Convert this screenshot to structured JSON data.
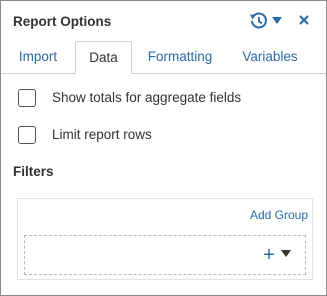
{
  "header": {
    "title": "Report Options",
    "history_icon": "history-icon",
    "close_icon": "close-icon"
  },
  "tabs": [
    {
      "label": "Import",
      "active": false
    },
    {
      "label": "Data",
      "active": true
    },
    {
      "label": "Formatting",
      "active": false
    },
    {
      "label": "Variables",
      "active": false
    }
  ],
  "options": {
    "show_totals": {
      "label": "Show totals for aggregate fields",
      "checked": false
    },
    "limit_rows": {
      "label": "Limit report rows",
      "checked": false
    }
  },
  "filters": {
    "title": "Filters",
    "add_group_label": "Add Group",
    "add_symbol": "+"
  },
  "colors": {
    "accent": "#2a6aa8",
    "text": "#333333",
    "border": "#8a8a8a"
  }
}
